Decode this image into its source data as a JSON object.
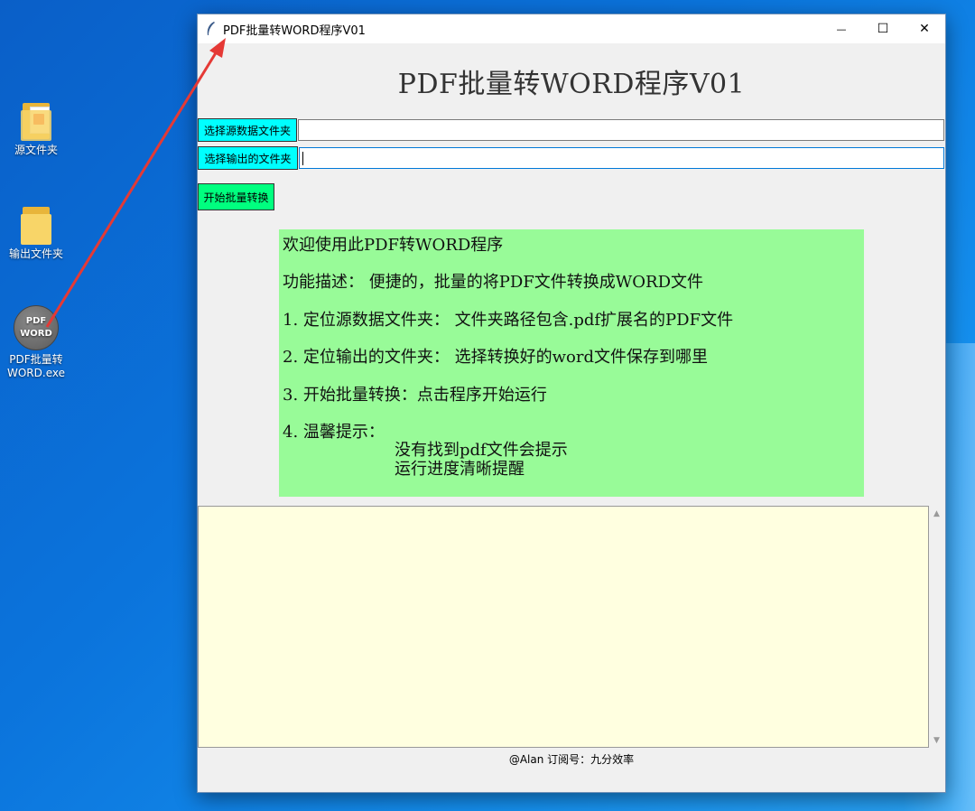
{
  "desktop": {
    "icons": [
      {
        "label": "源文件夹"
      },
      {
        "label": "输出文件夹"
      },
      {
        "label_line1": "PDF批量转",
        "label_line2": "WORD.exe",
        "badge_top": "PDF",
        "badge_bottom": "WORD"
      }
    ]
  },
  "window": {
    "title": "PDF批量转WORD程序V01",
    "controls": {
      "minimize": "—",
      "maximize": "☐",
      "close": "✕"
    }
  },
  "app": {
    "heading": "PDF批量转WORD程序V01",
    "source_button": "选择源数据文件夹",
    "source_value": "",
    "output_button": "选择输出的文件夹",
    "output_value": "",
    "start_button": "开始批量转换",
    "info": {
      "l1": "欢迎使用此PDF转WORD程序",
      "l2": "功能描述：  便捷的，批量的将PDF文件转换成WORD文件",
      "l3": "1.  定位源数据文件夹：  文件夹路径包含.pdf扩展名的PDF文件",
      "l4": "2.  定位输出的文件夹：  选择转换好的word文件保存到哪里",
      "l5": "3.  开始批量转换：点击程序开始运行",
      "l6": "4.  温馨提示：",
      "l7": "没有找到pdf文件会提示",
      "l8": "运行进度清晰提醒"
    },
    "log_text": "",
    "footer": "@Alan  订阅号：九分效率"
  },
  "colors": {
    "accent_arrow": "#e53935",
    "cyan_button": "#00ffff",
    "green_button": "#00ff7f",
    "info_panel": "#98fb98",
    "log_area": "#ffffe0"
  }
}
